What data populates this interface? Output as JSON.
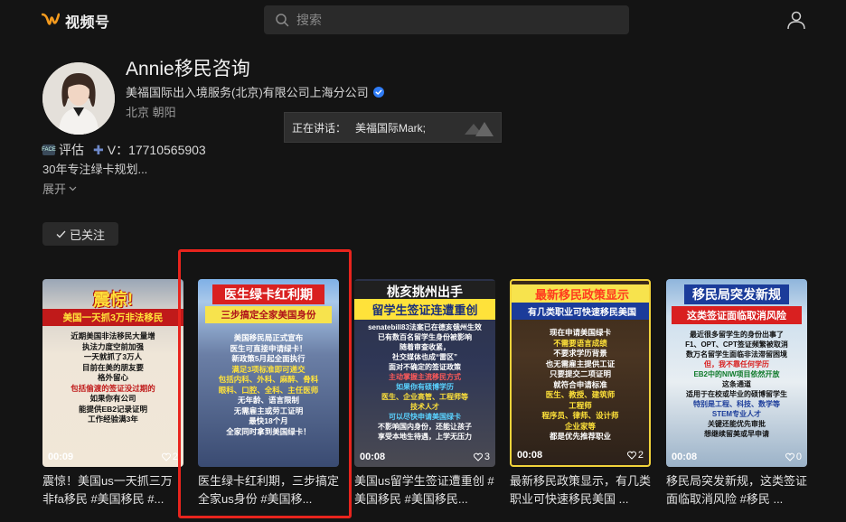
{
  "app": {
    "name": "视频号",
    "search_placeholder": "搜索"
  },
  "profile": {
    "name": "Annie移民咨询",
    "org": "美福国际出入境服务(北京)有限公司上海分公司",
    "location": "北京 朝阳",
    "bio_line1_tag": "评估",
    "bio_line1_contact": "V：17710565903",
    "bio_line2": "30年专注绿卡规划...",
    "expand_label": "展开",
    "follow_label": "已关注"
  },
  "speaking": {
    "label": "正在讲话：",
    "speaker": "美福国际Mark;"
  },
  "videos": [
    {
      "duration": "00:09",
      "likes": "2",
      "headline": "震惊!",
      "sub": "美国一天抓3万非法移民",
      "lines": [
        "近期美国非法移民大量增",
        "执法力度空前加强",
        "一天就抓了3万人",
        "目前在美的朋友要",
        "格外留心",
        "包括偷渡的签证没过期的",
        "如果你有公司",
        "能提供EB2记录证明",
        "工作经验满3年"
      ],
      "title": "震惊！美国us一天抓三万非fa移民 #美国移民 #..."
    },
    {
      "duration": "",
      "likes": "",
      "headline": "医生绿卡红利期",
      "sub": "三步搞定全家美国身份",
      "lines": [
        "美国移民局正式宣布",
        "医生可直接申请绿卡！",
        "新政策5月起全面执行",
        "满足3项标准即可递交",
        "包括内科、外科、麻醉、骨科",
        "眼科、口腔、全科、主任医师",
        "无年龄、语言限制",
        "无需雇主或劳工证明",
        "最快18个月",
        "全家同时拿到美国绿卡！"
      ],
      "title": "医生绿卡红利期，三步搞定全家us身份 #美国移..."
    },
    {
      "duration": "00:08",
      "likes": "3",
      "headline": "桃亥挑州出手",
      "sub": "留学生签证连遭重创",
      "lines": [
        "senatebill83法案已在德亥俄州生效",
        "已有数百名留学生身份被影响",
        "随着审查收紧，",
        "社交媒体也成“雷区”",
        "面对不确定的签证政策",
        "主动掌握主流移民方式",
        "如果你有硕博学历",
        "医生、企业高管、工程师等",
        "技术人才",
        "可以尽快申请美国绿卡",
        "不影响国内身份，还能让孩子",
        "享受本地生待遇，上学无压力"
      ],
      "title": "美国us留学生签证遭重创 #美国移民 #美国移民..."
    },
    {
      "duration": "00:08",
      "likes": "2",
      "headline": "最新移民政策显示",
      "sub": "有几类职业可快速移民美国",
      "lines": [
        "现在申请美国绿卡",
        "不需要语言成绩",
        "不要求学历背景",
        "也无需雇主提供工证",
        "只要提交二项证明",
        "就符合申请标准",
        "医生、教授、建筑师",
        "工程师",
        "程序员、律师、设计师",
        "企业家等",
        "都是优先推荐职业"
      ],
      "title": "最新移民政策显示，有几类职业可快速移民美国 ..."
    },
    {
      "duration": "00:08",
      "likes": "0",
      "headline": "移民局突发新规",
      "sub": "这类签证面临取消风险",
      "lines": [
        "最近很多留学生的身份出事了",
        "F1、OPT、CPT签证频繁被取消",
        "数万名留学生面临非法滞留困境",
        "但，我不靠任何学历",
        "EB2中的NIW项目依然开放",
        "这条通道",
        "适用于在校或毕业的硕博留学生",
        "特别是工程、科技、数学等",
        "STEM专业人才",
        "关键还能优先审批",
        "想继续留美或早申请"
      ],
      "title": "移民局突发新规，这类签证面临取消风险 #移民 ..."
    }
  ],
  "colors": {
    "accent_red": "#e8241d",
    "verify_blue": "#2f7cf6",
    "logo_orange": "#f39a1e"
  }
}
